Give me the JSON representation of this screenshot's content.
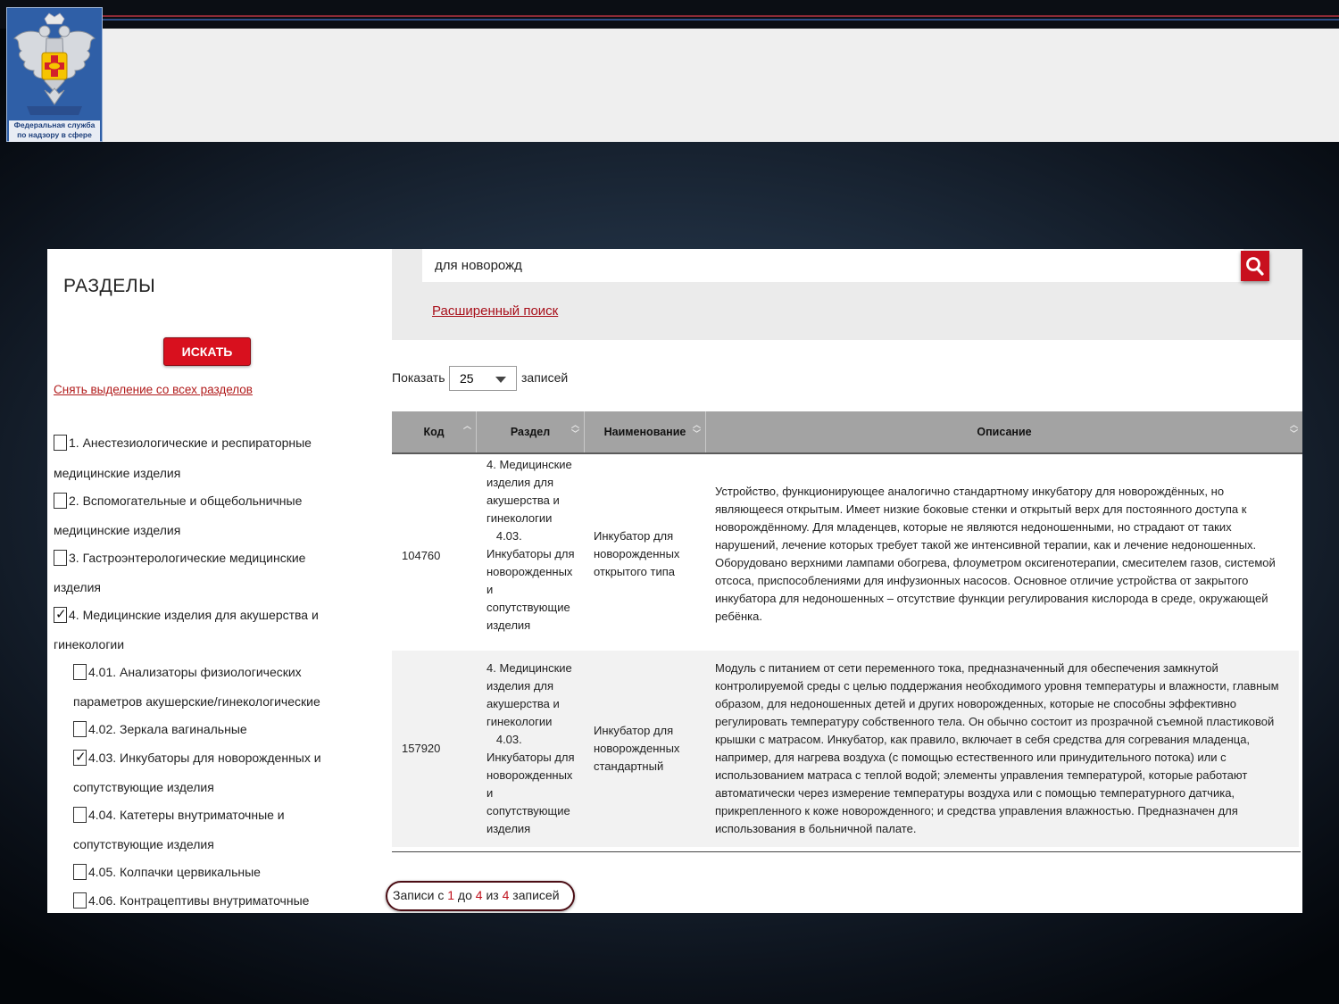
{
  "header": {
    "logo_text_line1": "Федеральная служба",
    "logo_text_line2": "по надзору в сфере",
    "colors": {
      "accent_red": "#d8101e",
      "logo_blue": "#2f5fa7"
    }
  },
  "sidebar": {
    "title": "РАЗДЕЛЫ",
    "search_button": "ИСКАТЬ",
    "clear_link": "Снять выделение со всех разделов",
    "items": [
      {
        "line1": "1. Анестезиологические и респираторные",
        "line2": "медицинские изделия",
        "checked": false
      },
      {
        "line1": "2. Вспомогательные и общебольничные",
        "line2": "медицинские изделия",
        "checked": false
      },
      {
        "line1": "3. Гастроэнтерологические медицинские",
        "line2": "изделия",
        "checked": false
      },
      {
        "line1": "4. Медицинские изделия для акушерства и",
        "line2": "гинекологии",
        "checked": true
      },
      {
        "line1": "4.01. Анализаторы физиологических",
        "line2": "параметров акушерские/гинекологические",
        "checked": false
      },
      {
        "line1": "4.02. Зеркала вагинальные",
        "line2": "",
        "checked": false
      },
      {
        "line1": "4.03. Инкубаторы для новорожденных и",
        "line2": "сопутствующие изделия",
        "checked": true
      },
      {
        "line1": "4.04. Катетеры внутриматочные и",
        "line2": "сопутствующие изделия",
        "checked": false
      },
      {
        "line1": "4.05. Колпачки цервикальные",
        "line2": "",
        "checked": false
      },
      {
        "line1": "4.06. Контрацептивы внутриматочные",
        "line2": "",
        "checked": false
      }
    ]
  },
  "search": {
    "value": "для новорожд",
    "search_icon": "magnifier-icon",
    "advanced_link": "Расширенный поиск"
  },
  "length_control": {
    "show_label": "Показать",
    "selected": "25",
    "records_label": "записей"
  },
  "table": {
    "headers": [
      "Код",
      "Раздел",
      "Наименование",
      "Описание"
    ],
    "rows": [
      {
        "code": "104760",
        "section_lines": [
          "4. Медицинские",
          "изделия для",
          "акушерства и",
          "гинекологии",
          "   4.03.",
          "Инкубаторы для",
          "новорожденных",
          "и",
          "сопутствующие",
          "изделия"
        ],
        "name_lines": [
          "Инкубатор для",
          "новорожденных",
          "открытого типа"
        ],
        "description_lines": [
          "Устройство, функционирующее аналогично стандартному инкубатору для новорождённых, но",
          "являющееся открытым. Имеет низкие боковые стенки и открытый верх для постоянного доступа к",
          "новорождённому. Для младенцев, которые не являются недоношенными, но страдают от таких",
          "нарушений, лечение которых требует такой же интенсивной терапии, как и лечение недоношенных.",
          "Оборудовано верхними лампами обогрева, флоуметром оксигенотерапии, смесителем газов, системой",
          "отсоса, приспособлениями для инфузионных насосов. Основное отличие устройства от закрытого",
          "инкубатора для недоношенных – отсутствие функции регулирования кислорода в среде, окружающей",
          "ребёнка."
        ]
      },
      {
        "code": "157920",
        "section_lines": [
          "4. Медицинские",
          "изделия для",
          "акушерства и",
          "гинекологии",
          "   4.03.",
          "Инкубаторы для",
          "новорожденных",
          "и",
          "сопутствующие",
          "изделия"
        ],
        "name_lines": [
          "Инкубатор для",
          "новорожденных",
          "стандартный"
        ],
        "description_lines": [
          "Модуль с питанием от сети переменного тока, предназначенный для обеспечения замкнутой",
          "контролируемой среды с целью поддержания необходимого уровня температуры и влажности, главным",
          "образом, для недоношенных детей и других новорожденных, которые не способны эффективно",
          "регулировать температуру собственного тела. Он обычно состоит из прозрачной съемной пластиковой",
          "крышки с матрасом. Инкубатор, как правило, включает в себя средства для согревания младенца,",
          "например, для нагрева воздуха (с помощью естественного или принудительного потока) или с",
          "использованием матраса с теплой водой; элементы управления температурой, которые работают",
          "автоматически через измерение температуры воздуха или с помощью температурного датчика,",
          "прикрепленного к коже новорожденного; и средства управления влажностью. Предназначен для",
          "использования в больничной палате."
        ]
      }
    ]
  },
  "info": {
    "prefix": "Записи с ",
    "from": "1",
    "mid1": " до ",
    "to": "4",
    "mid2": " из ",
    "total": "4",
    "suffix": " записей"
  }
}
